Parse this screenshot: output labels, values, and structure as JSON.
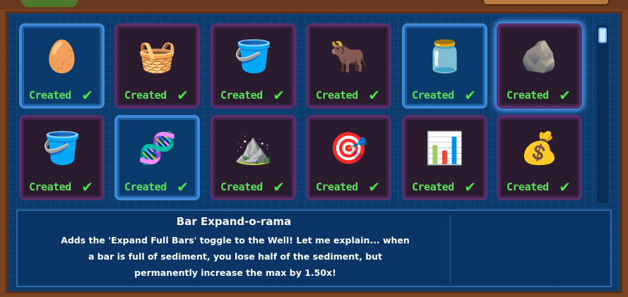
{
  "grid": {
    "status_label": "Created",
    "items": [
      {
        "icon": "rainbow-egg-icon",
        "glyph": "🥚",
        "selected": true
      },
      {
        "icon": "ore-basket-upgrade-icon",
        "glyph": "🧺",
        "selected": false
      },
      {
        "icon": "ore-bucket-icon",
        "glyph": "🪣",
        "selected": false
      },
      {
        "icon": "demon-bull-icon",
        "glyph": "🐂",
        "selected": false
      },
      {
        "icon": "potion-jar-icon",
        "glyph": "🫙",
        "selected": true
      },
      {
        "icon": "ore-crate-icon",
        "glyph": "🪨",
        "selected": false,
        "glow": true
      },
      {
        "icon": "bucket-plus-icon",
        "glyph": "🪣",
        "selected": false
      },
      {
        "icon": "dna-ore-icon",
        "glyph": "🧬",
        "selected": true
      },
      {
        "icon": "ore-mound-basket-icon",
        "glyph": "⛰️",
        "selected": false
      },
      {
        "icon": "target-stone-icon",
        "glyph": "🎯",
        "selected": false
      },
      {
        "icon": "sediment-bars-icon",
        "glyph": "📊",
        "selected": false
      },
      {
        "icon": "gold-basket-icon",
        "glyph": "💰",
        "selected": false
      }
    ]
  },
  "description": {
    "title": "Bar Expand-o-rama",
    "lines": [
      "Adds the 'Expand Full Bars' toggle to the Well! Let me explain... when",
      "a bar is full of sediment, you lose half of the sediment, but",
      "permanently increase the max by 1.50x!"
    ]
  }
}
